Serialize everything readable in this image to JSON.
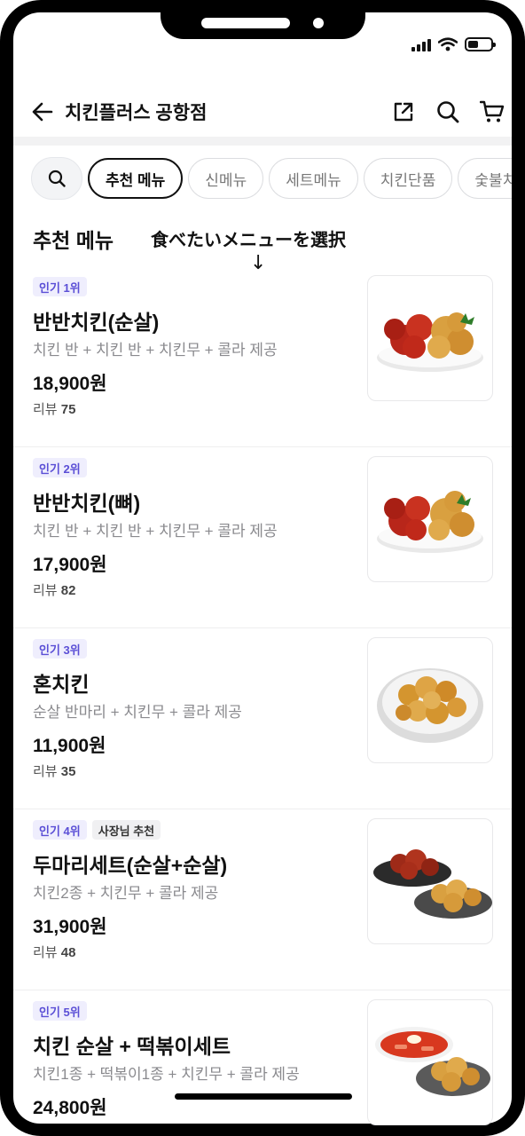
{
  "header": {
    "title": "치킨플러스 공항점"
  },
  "chips": [
    "추천 메뉴",
    "신메뉴",
    "세트메뉴",
    "치킨단품",
    "숯불치킨"
  ],
  "section": {
    "title": "추천 메뉴"
  },
  "annotation": {
    "text": "食べたいメニューを選択",
    "arrow": "↓"
  },
  "review_label": "리뷰",
  "items": [
    {
      "badges": [
        "인기 1위"
      ],
      "name": "반반치킨(순살)",
      "desc": "치킨 반 + 치킨 반 + 치킨무 + 콜라 제공",
      "price": "18,900원",
      "reviews": "75",
      "image": "red-yellow-chicken-plate"
    },
    {
      "badges": [
        "인기 2위"
      ],
      "name": "반반치킨(뼈)",
      "desc": "치킨 반 + 치킨 반 + 치킨무 + 콜라 제공",
      "price": "17,900원",
      "reviews": "82",
      "image": "red-yellow-chicken-plate"
    },
    {
      "badges": [
        "인기 3위"
      ],
      "name": "혼치킨",
      "desc": "순살 반마리 + 치킨무 + 콜라 제공",
      "price": "11,900원",
      "reviews": "35",
      "image": "boneless-chicken-bowl"
    },
    {
      "badges": [
        "인기 4위",
        "사장님 추천"
      ],
      "name": "두마리세트(순살+순살)",
      "desc": "치킨2종 + 치킨무 + 콜라 제공",
      "price": "31,900원",
      "reviews": "48",
      "image": "two-chicken-plates"
    },
    {
      "badges": [
        "인기 5위"
      ],
      "name": "치킨 순살 + 떡볶이세트",
      "desc": "치킨1종 + 떡볶이1종 + 치킨무 + 콜라 제공",
      "price": "24,800원",
      "reviews": "",
      "image": "tteokbokki-and-chicken"
    }
  ],
  "colors": {
    "badge_text": "#5b4fd6",
    "badge_bg": "#efeefd",
    "sauce_red": "#c0291a",
    "fried_gold": "#d89a3a"
  }
}
